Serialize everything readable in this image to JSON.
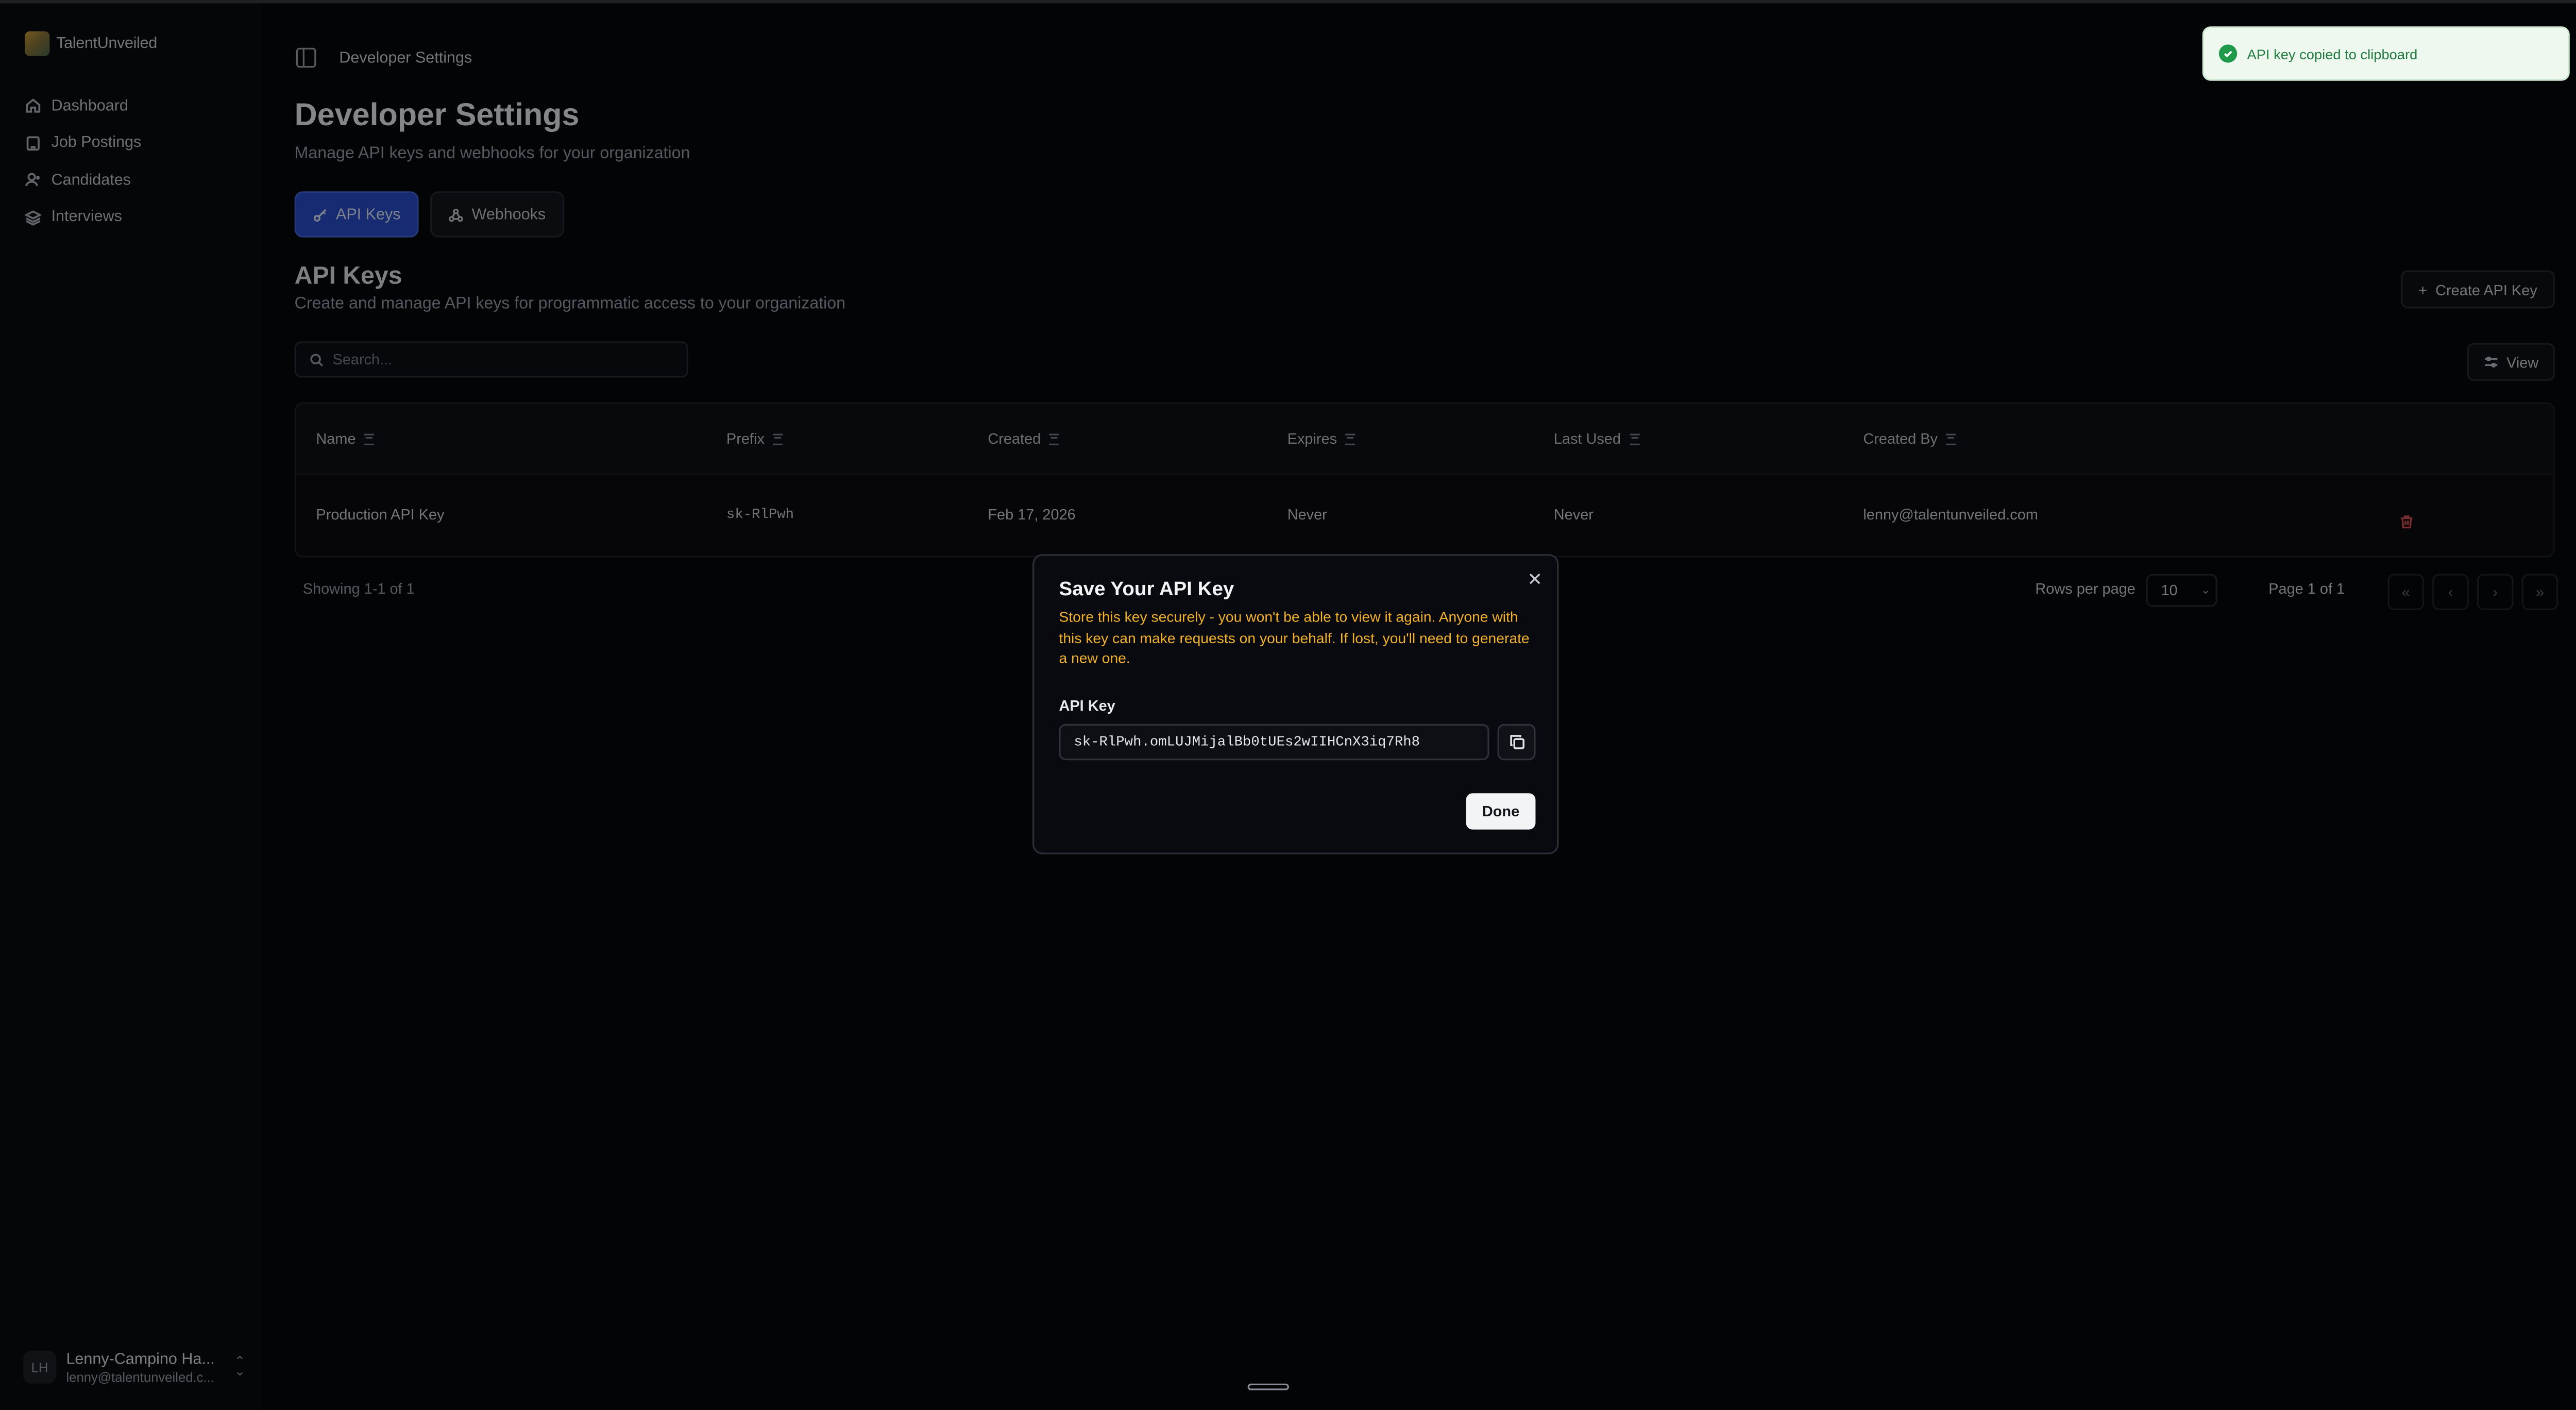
{
  "app": {
    "name": "TalentUnveiled"
  },
  "sidebar": {
    "items": [
      {
        "label": "Dashboard",
        "icon": "home-icon"
      },
      {
        "label": "Job Postings",
        "icon": "building-icon"
      },
      {
        "label": "Candidates",
        "icon": "user-icon"
      },
      {
        "label": "Interviews",
        "icon": "layers-icon"
      }
    ],
    "user": {
      "initials": "LH",
      "name": "Lenny-Campino Ha...",
      "email": "lenny@talentunveiled.c..."
    }
  },
  "header": {
    "breadcrumb": "Developer Settings"
  },
  "page": {
    "title": "Developer Settings",
    "subtitle": "Manage API keys and webhooks for your organization",
    "tabs": [
      {
        "label": "API Keys",
        "active": true
      },
      {
        "label": "Webhooks",
        "active": false
      }
    ]
  },
  "section": {
    "title": "API Keys",
    "subtitle": "Create and manage API keys for programmatic access to your organization",
    "create_label": "Create API Key",
    "search_placeholder": "Search...",
    "view_label": "View"
  },
  "table": {
    "columns": [
      "Name",
      "Prefix",
      "Created",
      "Expires",
      "Last Used",
      "Created By"
    ],
    "rows": [
      {
        "name": "Production API Key",
        "prefix": "sk-RlPwh",
        "created": "Feb 17, 2026",
        "expires": "Never",
        "last_used": "Never",
        "created_by": "lenny@talentunveiled.com"
      }
    ]
  },
  "pagination": {
    "showing": "Showing 1-1 of 1",
    "rows_per_page_label": "Rows per page",
    "rows_per_page_value": "10",
    "page_label": "Page 1 of 1"
  },
  "modal": {
    "title": "Save Your API Key",
    "warning": "Store this key securely - you won't be able to view it again. Anyone with this key can make requests on your behalf. If lost, you'll need to generate a new one.",
    "key_label": "API Key",
    "key_value": "sk-RlPwh.omLUJMijalBb0tUEs2wIIHCnX3iq7Rh8",
    "done_label": "Done"
  },
  "toast": {
    "message": "API key copied to clipboard"
  },
  "colors": {
    "accent": "#2b4fd0",
    "warning": "#f2b12b",
    "danger": "#e05252",
    "success": "#1f9a4b"
  }
}
